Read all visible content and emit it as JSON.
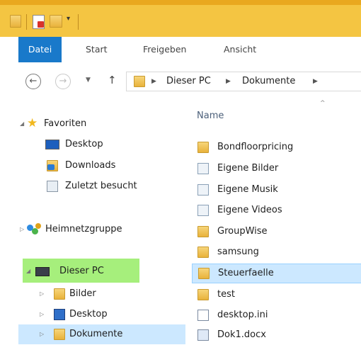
{
  "ribbon": {
    "tabs": [
      "Datei",
      "Start",
      "Freigeben",
      "Ansicht"
    ],
    "active_color": "#1979ca"
  },
  "address": {
    "path": [
      "Dieser PC",
      "Dokumente"
    ]
  },
  "nav": {
    "favorites": "Favoriten",
    "fav_items": [
      "Desktop",
      "Downloads",
      "Zuletzt besucht"
    ],
    "homegroup": "Heimnetzgruppe",
    "this_pc": "Dieser PC",
    "pc_items": [
      "Bilder",
      "Desktop",
      "Dokumente"
    ],
    "highlight_color": "#a6ef7c",
    "selected_color": "#cce8ff"
  },
  "files": {
    "column_name": "Name",
    "items": [
      {
        "name": "Bondfloorpricing",
        "icon": "folder-icon"
      },
      {
        "name": "Eigene Bilder",
        "icon": "shortcut-icon"
      },
      {
        "name": "Eigene Musik",
        "icon": "shortcut-icon"
      },
      {
        "name": "Eigene Videos",
        "icon": "shortcut-icon"
      },
      {
        "name": "GroupWise",
        "icon": "folder-icon"
      },
      {
        "name": "samsung",
        "icon": "folder-icon"
      },
      {
        "name": "Steuerfaelle",
        "icon": "folder-icon"
      },
      {
        "name": "test",
        "icon": "folder-icon"
      },
      {
        "name": "desktop.ini",
        "icon": "settings-file-icon"
      },
      {
        "name": "Dok1.docx",
        "icon": "word-document-icon"
      }
    ]
  }
}
